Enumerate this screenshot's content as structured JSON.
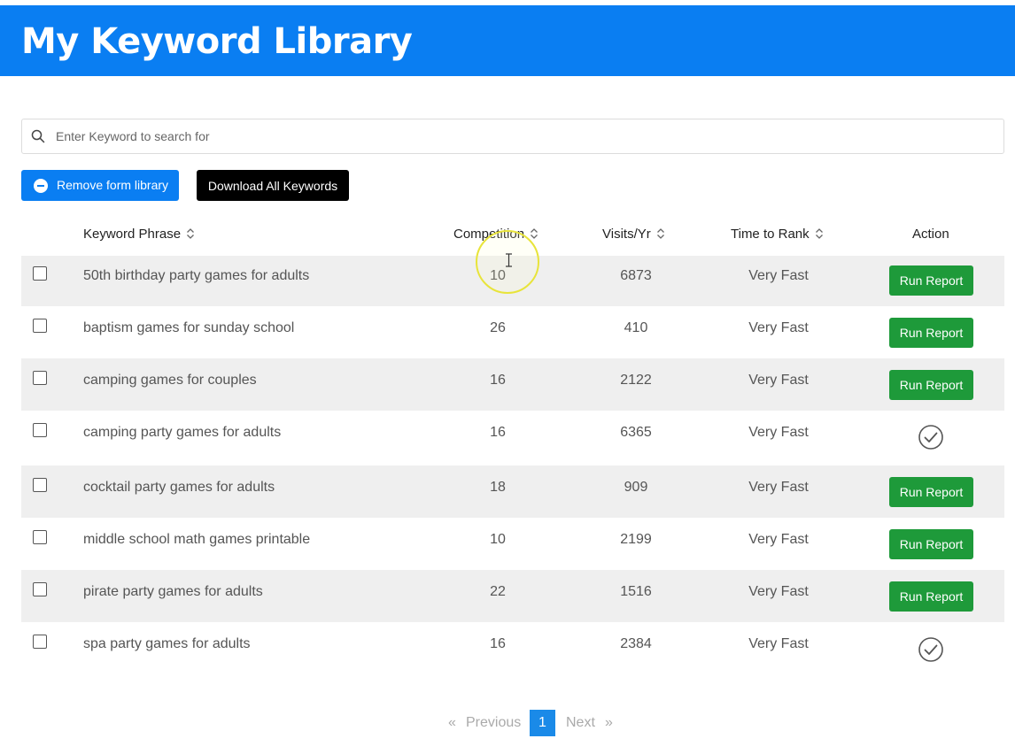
{
  "header": {
    "title": "My Keyword Library"
  },
  "search": {
    "placeholder": "Enter Keyword to search for",
    "value": ""
  },
  "toolbar": {
    "remove_label": "Remove form library",
    "download_label": "Download All Keywords"
  },
  "table": {
    "columns": [
      "Keyword Phrase",
      "Competition",
      "Visits/Yr",
      "Time to Rank",
      "Action"
    ],
    "run_label": "Run Report",
    "rows": [
      {
        "keyword": "50th birthday party games for adults",
        "competition": "10",
        "visits": "6873",
        "time": "Very Fast",
        "action": "run"
      },
      {
        "keyword": "baptism games for sunday school",
        "competition": "26",
        "visits": "410",
        "time": "Very Fast",
        "action": "run"
      },
      {
        "keyword": "camping games for couples",
        "competition": "16",
        "visits": "2122",
        "time": "Very Fast",
        "action": "run"
      },
      {
        "keyword": "camping party games for adults",
        "competition": "16",
        "visits": "6365",
        "time": "Very Fast",
        "action": "done"
      },
      {
        "keyword": "cocktail party games for adults",
        "competition": "18",
        "visits": "909",
        "time": "Very Fast",
        "action": "run"
      },
      {
        "keyword": "middle school math games printable",
        "competition": "10",
        "visits": "2199",
        "time": "Very Fast",
        "action": "run"
      },
      {
        "keyword": "pirate party games for adults",
        "competition": "22",
        "visits": "1516",
        "time": "Very Fast",
        "action": "run"
      },
      {
        "keyword": "spa party games for adults",
        "competition": "16",
        "visits": "2384",
        "time": "Very Fast",
        "action": "done"
      }
    ]
  },
  "pagination": {
    "prev_arrow": "«",
    "previous": "Previous",
    "current": "1",
    "next": "Next",
    "next_arrow": "»"
  },
  "colors": {
    "header": "#0a7ef2",
    "run_button": "#1e9a3a",
    "download_button": "#000000",
    "page_current": "#1a8ae8"
  }
}
